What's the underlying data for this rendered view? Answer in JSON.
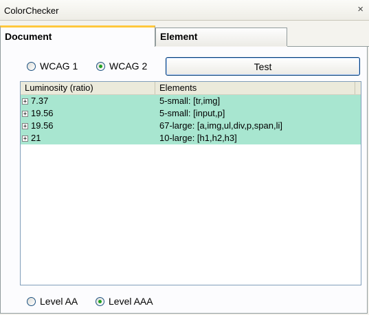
{
  "window": {
    "title": "ColorChecker",
    "close_glyph": "×"
  },
  "tabs": [
    {
      "label": "Document",
      "active": true
    },
    {
      "label": "Element",
      "active": false
    }
  ],
  "wcag": {
    "option1": {
      "label": "WCAG 1",
      "checked": false
    },
    "option2": {
      "label": "WCAG 2",
      "checked": true
    }
  },
  "test_button": {
    "label": "Test"
  },
  "grid": {
    "columns": [
      "Luminosity (ratio)",
      "Elements"
    ],
    "rows": [
      {
        "ratio": "7.37",
        "elements": "5-small: [tr,img]"
      },
      {
        "ratio": "19.56",
        "elements": "5-small: [input,p]"
      },
      {
        "ratio": "19.56",
        "elements": "67-large: [a,img,ul,div,p,span,li]"
      },
      {
        "ratio": "21",
        "elements": "10-large: [h1,h2,h3]"
      }
    ],
    "row_color": "#a8e6d0",
    "expander_glyph": "+"
  },
  "level": {
    "option1": {
      "label": "Level AA",
      "checked": false
    },
    "option2": {
      "label": "Level AAA",
      "checked": true
    }
  }
}
